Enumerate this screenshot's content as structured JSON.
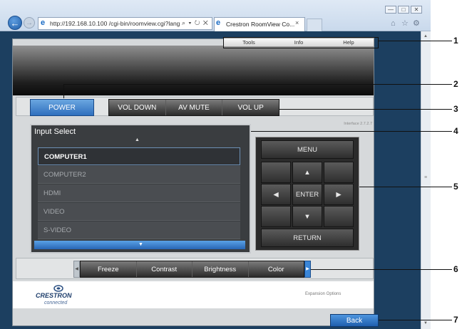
{
  "browser": {
    "address": "http://192.168.10.100 /cgi-bin/roomview.cgi?lang",
    "address_controls": "⌕ ▾ ↻ ✕",
    "tab_title": "Crestron RoomView Co...",
    "tab_close": "×"
  },
  "top_menu": [
    "Tools",
    "Info",
    "Help"
  ],
  "control_bar": {
    "power": "POWER",
    "volume": [
      "VOL DOWN",
      "AV MUTE",
      "VOL UP"
    ]
  },
  "interface_version": "Interface 2.7.2.7",
  "input_select": {
    "title": "Input Select",
    "items": [
      "COMPUTER1",
      "COMPUTER2",
      "HDMI",
      "VIDEO",
      "S-VIDEO"
    ],
    "selected": "COMPUTER1"
  },
  "remote": {
    "menu": "MENU",
    "enter": "ENTER",
    "return": "RETURN"
  },
  "toolbar": [
    "Freeze",
    "Contrast",
    "Brightness",
    "Color"
  ],
  "footer": {
    "logo_text": "CRESTRON",
    "logo_sub": "connected",
    "expansion": "Expansion Options",
    "back": "Back"
  },
  "callouts": [
    "1",
    "2",
    "3",
    "4",
    "5",
    "6",
    "7"
  ],
  "icons": {
    "back_nav": "back-arrow-icon",
    "forward_nav": "forward-arrow-icon",
    "home": "home-icon",
    "favorites": "star-icon",
    "settings": "gear-icon"
  },
  "colors": {
    "accent_blue": "#2f6fbe",
    "page_background": "#1c3f60"
  }
}
